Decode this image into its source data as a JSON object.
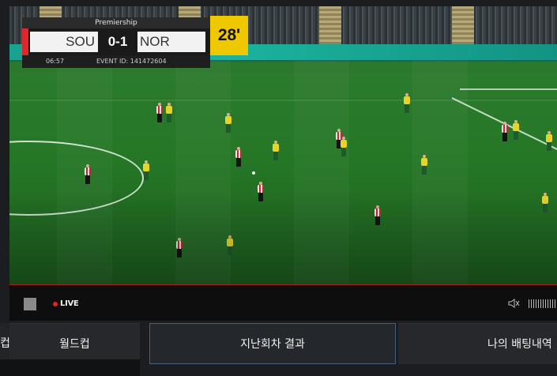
{
  "scoreboard": {
    "league": "Premiership",
    "home_team": "SOU",
    "score": "0-1",
    "away_team": "NOR",
    "clock": "06:57",
    "event_id": "EVENT ID: 141472604",
    "minute": "28'"
  },
  "player_controls": {
    "live_label": "LIVE"
  },
  "tabs": [
    {
      "label": "컵"
    },
    {
      "label": "월드컵"
    },
    {
      "label": "지난회차 결과"
    },
    {
      "label": "나의 배팅내역"
    }
  ],
  "colors": {
    "live_dot": "#e52222",
    "minute_badge": "#f0c800",
    "home_marker": "#e0262b",
    "active_tab_border": "#43617b"
  }
}
